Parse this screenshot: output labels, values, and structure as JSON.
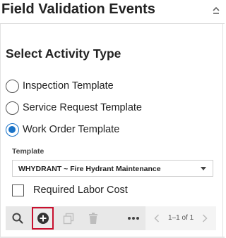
{
  "panel": {
    "title": "Field Validation Events",
    "collapse_icon": "chevron-up-collapse-icon"
  },
  "activity": {
    "heading": "Select Activity Type",
    "options": [
      {
        "label": "Inspection Template",
        "checked": false
      },
      {
        "label": "Service Request Template",
        "checked": false
      },
      {
        "label": "Work Order Template",
        "checked": true
      }
    ]
  },
  "template": {
    "label": "Template",
    "selected": "WHYDRANT ~ Fire Hydrant Maintenance"
  },
  "required_labor_cost": {
    "label": "Required Labor Cost",
    "checked": false
  },
  "toolbar": {
    "icons": [
      "search-icon",
      "add-circle-icon",
      "copy-icon",
      "trash-icon",
      "more-icon"
    ],
    "accent": "#c8102e"
  },
  "pager": {
    "count": "1–1 of 1"
  },
  "colors": {
    "radio_accent": "#1b73c7"
  }
}
